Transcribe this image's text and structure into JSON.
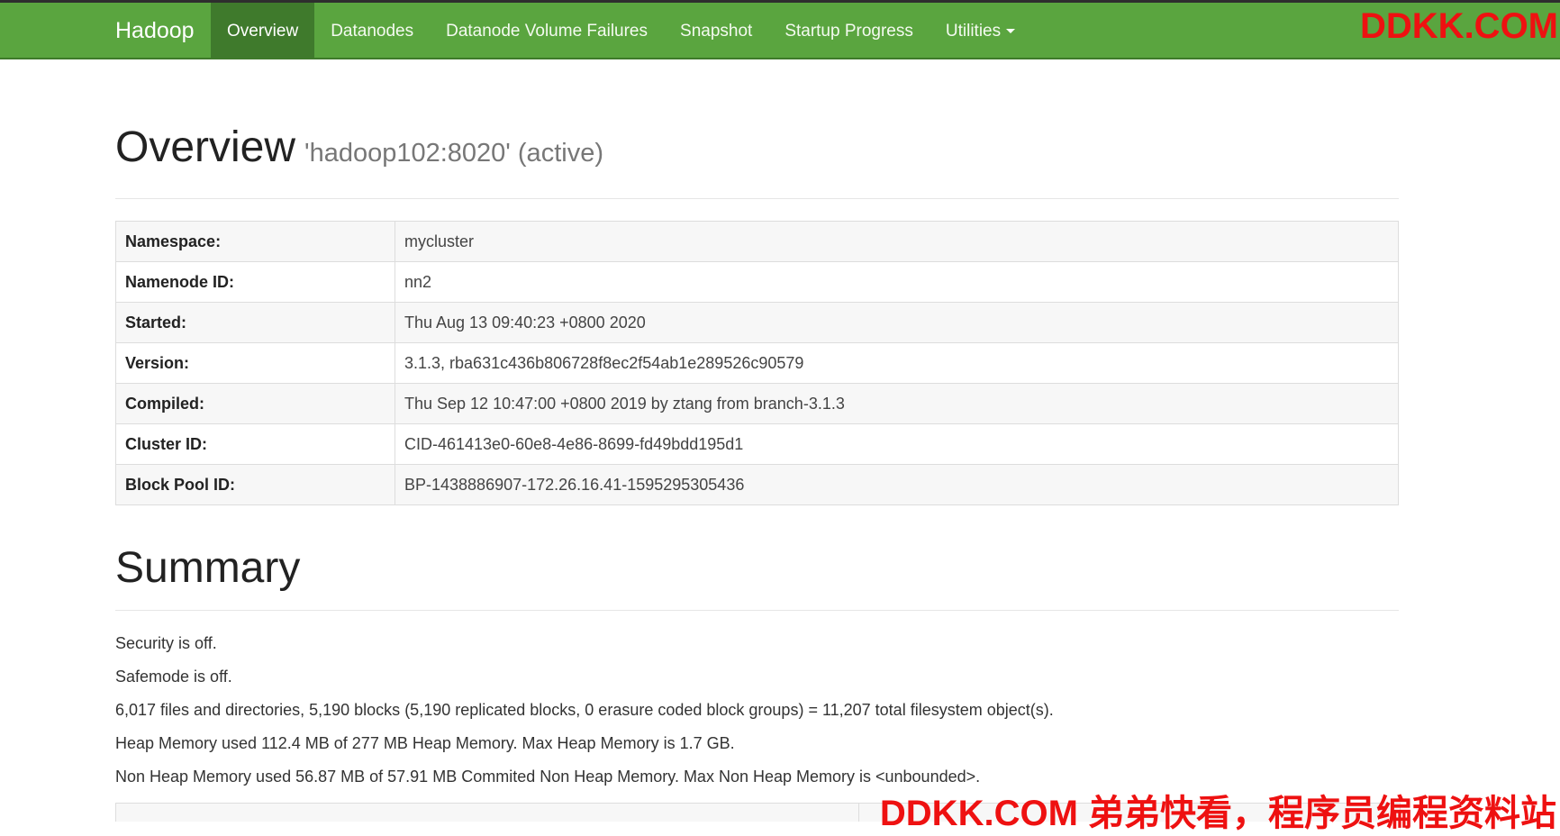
{
  "navbar": {
    "brand": "Hadoop",
    "items": [
      {
        "label": "Overview",
        "active": true
      },
      {
        "label": "Datanodes"
      },
      {
        "label": "Datanode Volume Failures"
      },
      {
        "label": "Snapshot"
      },
      {
        "label": "Startup Progress"
      },
      {
        "label": "Utilities"
      }
    ],
    "color": "#5aa53f",
    "active_color": "#3f7a2c"
  },
  "watermark": {
    "top": "DDKK.COM",
    "bottom": "DDKK.COM 弟弟快看，程序员编程资料站",
    "color": "#ee1111"
  },
  "overview": {
    "title": "Overview",
    "subtitle": "'hadoop102:8020' (active)",
    "rows": [
      {
        "key": "Namespace:",
        "value": "mycluster"
      },
      {
        "key": "Namenode ID:",
        "value": "nn2"
      },
      {
        "key": "Started:",
        "value": "Thu Aug 13 09:40:23 +0800 2020"
      },
      {
        "key": "Version:",
        "value": "3.1.3, rba631c436b806728f8ec2f54ab1e289526c90579"
      },
      {
        "key": "Compiled:",
        "value": "Thu Sep 12 10:47:00 +0800 2019 by ztang from branch-3.1.3"
      },
      {
        "key": "Cluster ID:",
        "value": "CID-461413e0-60e8-4e86-8699-fd49bdd195d1"
      },
      {
        "key": "Block Pool ID:",
        "value": "BP-1438886907-172.26.16.41-1595295305436"
      }
    ]
  },
  "summary": {
    "title": "Summary",
    "lines": [
      "Security is off.",
      "Safemode is off.",
      "6,017 files and directories, 5,190 blocks (5,190 replicated blocks, 0 erasure coded block groups) = 11,207 total filesystem object(s).",
      "Heap Memory used 112.4 MB of 277 MB Heap Memory. Max Heap Memory is 1.7 GB.",
      "Non Heap Memory used 56.87 MB of 57.91 MB Commited Non Heap Memory. Max Non Heap Memory is <unbounded>."
    ]
  }
}
